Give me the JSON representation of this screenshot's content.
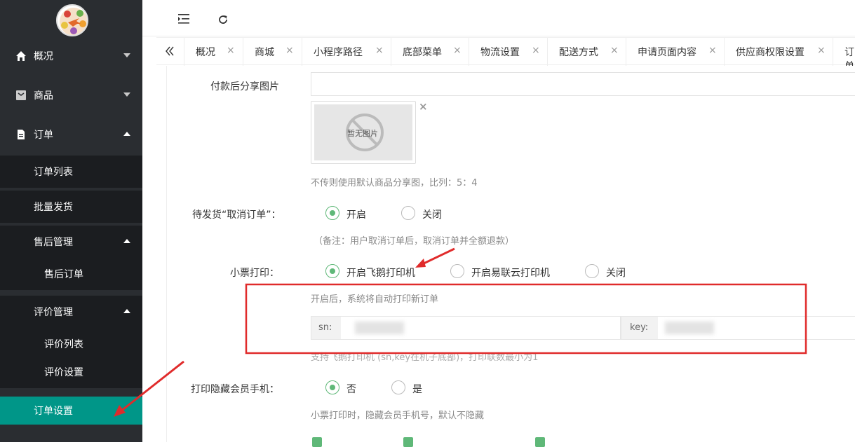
{
  "sidebar": {
    "top": [
      {
        "label": "概况"
      },
      {
        "label": "商品"
      },
      {
        "label": "订单"
      }
    ],
    "sub": {
      "order_list": "订单列表",
      "batch_ship": "批量发货",
      "after_sales": "售后管理",
      "after_sales_order": "售后订单",
      "review_mgmt": "评价管理",
      "review_list": "评价列表",
      "review_settings": "评价设置",
      "order_settings": "订单设置"
    }
  },
  "tabs": {
    "collapse_icon": "double-chevron-left-icon",
    "items": [
      {
        "label": "概况"
      },
      {
        "label": "商城"
      },
      {
        "label": "小程序路径"
      },
      {
        "label": "底部菜单"
      },
      {
        "label": "物流设置"
      },
      {
        "label": "配送方式"
      },
      {
        "label": "申请页面内容"
      },
      {
        "label": "供应商权限设置"
      },
      {
        "label": "订单"
      }
    ],
    "close": "×"
  },
  "form": {
    "share_image": {
      "label": "付款后分享图片",
      "placeholder_text": "暂无图片",
      "remove": "×",
      "hint": "不传则使用默认商品分享图，比列：5：4"
    },
    "cancel_order": {
      "label": "待发货“取消订单”：",
      "options": [
        "开启",
        "关闭"
      ],
      "hint": "（备注：用户取消订单后，取消订单并全额退款）"
    },
    "ticket_print": {
      "label": "小票打印：",
      "options": [
        "开启飞鹅打印机",
        "开启易联云打印机",
        "关闭"
      ],
      "hint": "开启后，系统将自动打印新订单",
      "sn_label": "sn:",
      "key_label": "key:",
      "support_hint": "支持飞鹅打印机 (sn,key在机子底部)，打印联数最小为1"
    },
    "hide_phone": {
      "label": "打印隐藏会员手机：",
      "options": [
        "否",
        "是"
      ],
      "hint": "小票打印时，隐藏会员手机号，默认不隐藏"
    }
  },
  "colors": {
    "sidebar_bg": "#2a2d31",
    "active": "#009688",
    "radio_on": "#5fb878",
    "annotation": "#e02b2b"
  }
}
